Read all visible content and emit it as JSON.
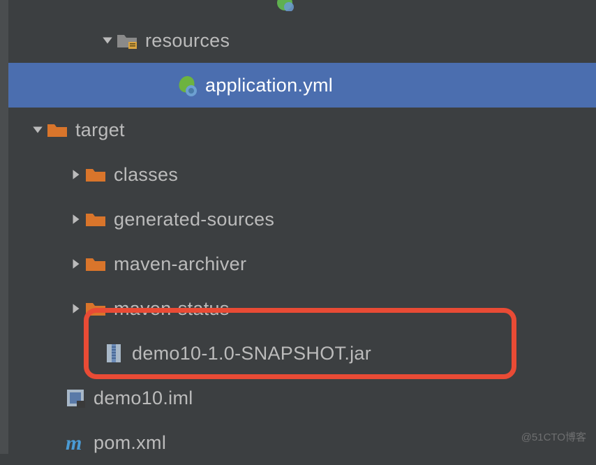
{
  "tree": {
    "partial_top": "",
    "resources": {
      "label": "resources"
    },
    "application_yml": {
      "label": "application.yml"
    },
    "target": {
      "label": "target"
    },
    "classes": {
      "label": "classes"
    },
    "generated_sources": {
      "label": "generated-sources"
    },
    "maven_archiver": {
      "label": "maven-archiver"
    },
    "maven_status": {
      "label": "maven-status"
    },
    "snapshot_jar": {
      "label": "demo10-1.0-SNAPSHOT.jar"
    },
    "demo_iml": {
      "label": "demo10.iml"
    },
    "pom_xml": {
      "label": "pom.xml"
    }
  },
  "watermark": "@51CTO博客"
}
